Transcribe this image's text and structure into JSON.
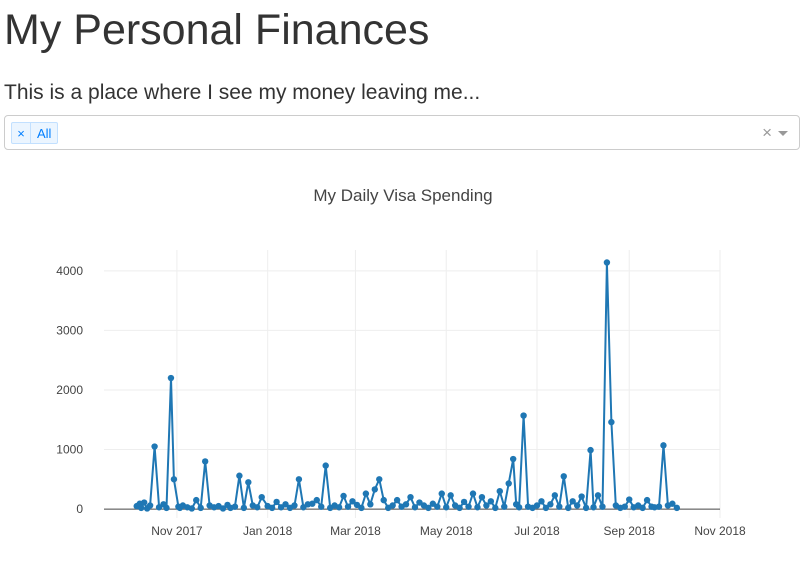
{
  "header": {
    "title": "My Personal Finances",
    "subtitle": "This is a place where I see my money leaving me..."
  },
  "filter": {
    "selected": [
      "All"
    ],
    "remove_glyph": "×",
    "clear_glyph": "×"
  },
  "colors": {
    "series": "#1f77b4",
    "grid": "#eeeeee",
    "zeroline": "#444444"
  },
  "chart_data": {
    "type": "line",
    "mode": "lines+markers",
    "title": "My Daily Visa Spending",
    "xlabel": "",
    "ylabel": "",
    "xlim": [
      "2017-09-13",
      "2018-11-01"
    ],
    "ylim": [
      -150,
      4350
    ],
    "x_ticks": [
      "2017-11-01",
      "2018-01-01",
      "2018-03-01",
      "2018-05-01",
      "2018-07-01",
      "2018-09-01",
      "2018-11-01"
    ],
    "x_tick_labels": [
      "Nov 2017",
      "Jan 2018",
      "Mar 2018",
      "May 2018",
      "Jul 2018",
      "Sep 2018",
      "Nov 2018"
    ],
    "y_ticks": [
      0,
      1000,
      2000,
      3000,
      4000
    ],
    "y_tick_labels": [
      "0",
      "1000",
      "2000",
      "3000",
      "4000"
    ],
    "grid": true,
    "series": [
      {
        "x": [
          "2017-10-05",
          "2017-10-07",
          "2017-10-08",
          "2017-10-10",
          "2017-10-12",
          "2017-10-14",
          "2017-10-17",
          "2017-10-20",
          "2017-10-23",
          "2017-10-25",
          "2017-10-28",
          "2017-10-30",
          "2017-11-02",
          "2017-11-03",
          "2017-11-05",
          "2017-11-08",
          "2017-11-11",
          "2017-11-14",
          "2017-11-17",
          "2017-11-20",
          "2017-11-23",
          "2017-11-26",
          "2017-11-29",
          "2017-12-02",
          "2017-12-05",
          "2017-12-07",
          "2017-12-10",
          "2017-12-13",
          "2017-12-16",
          "2017-12-19",
          "2017-12-22",
          "2017-12-25",
          "2017-12-28",
          "2018-01-01",
          "2018-01-04",
          "2018-01-07",
          "2018-01-10",
          "2018-01-13",
          "2018-01-16",
          "2018-01-19",
          "2018-01-22",
          "2018-01-25",
          "2018-01-28",
          "2018-01-31",
          "2018-02-03",
          "2018-02-06",
          "2018-02-09",
          "2018-02-12",
          "2018-02-15",
          "2018-02-18",
          "2018-02-21",
          "2018-02-24",
          "2018-02-27",
          "2018-03-02",
          "2018-03-05",
          "2018-03-08",
          "2018-03-11",
          "2018-03-14",
          "2018-03-17",
          "2018-03-20",
          "2018-03-23",
          "2018-03-26",
          "2018-03-29",
          "2018-04-01",
          "2018-04-04",
          "2018-04-07",
          "2018-04-10",
          "2018-04-13",
          "2018-04-16",
          "2018-04-19",
          "2018-04-22",
          "2018-04-25",
          "2018-04-28",
          "2018-05-01",
          "2018-05-04",
          "2018-05-07",
          "2018-05-10",
          "2018-05-13",
          "2018-05-16",
          "2018-05-19",
          "2018-05-22",
          "2018-05-25",
          "2018-05-28",
          "2018-05-31",
          "2018-06-03",
          "2018-06-06",
          "2018-06-09",
          "2018-06-12",
          "2018-06-15",
          "2018-06-17",
          "2018-06-19",
          "2018-06-22",
          "2018-06-25",
          "2018-06-28",
          "2018-07-01",
          "2018-07-04",
          "2018-07-07",
          "2018-07-10",
          "2018-07-13",
          "2018-07-16",
          "2018-07-19",
          "2018-07-22",
          "2018-07-25",
          "2018-07-28",
          "2018-07-31",
          "2018-08-03",
          "2018-08-06",
          "2018-08-08",
          "2018-08-11",
          "2018-08-14",
          "2018-08-17",
          "2018-08-20",
          "2018-08-23",
          "2018-08-26",
          "2018-08-29",
          "2018-09-01",
          "2018-09-04",
          "2018-09-07",
          "2018-09-10",
          "2018-09-13",
          "2018-09-16",
          "2018-09-18",
          "2018-09-21",
          "2018-09-24",
          "2018-09-27",
          "2018-09-30",
          "2018-10-03"
        ],
        "y": [
          50,
          90,
          20,
          110,
          10,
          60,
          1050,
          30,
          80,
          20,
          2200,
          500,
          40,
          20,
          60,
          30,
          10,
          150,
          20,
          800,
          60,
          30,
          50,
          10,
          70,
          20,
          40,
          560,
          20,
          450,
          60,
          30,
          200,
          50,
          20,
          120,
          30,
          80,
          20,
          60,
          500,
          30,
          80,
          90,
          150,
          40,
          730,
          20,
          60,
          30,
          220,
          40,
          130,
          70,
          20,
          260,
          80,
          330,
          500,
          150,
          20,
          60,
          150,
          40,
          80,
          200,
          30,
          110,
          60,
          20,
          90,
          40,
          260,
          30,
          230,
          60,
          20,
          120,
          40,
          260,
          30,
          200,
          60,
          130,
          20,
          300,
          40,
          430,
          840,
          80,
          30,
          1570,
          40,
          20,
          60,
          130,
          20,
          80,
          230,
          40,
          550,
          20,
          130,
          60,
          210,
          20,
          990,
          30,
          230,
          40,
          4140,
          1460,
          60,
          20,
          40,
          160,
          30,
          60,
          20,
          150,
          40,
          30,
          40,
          1070,
          60,
          90,
          20
        ]
      }
    ]
  }
}
